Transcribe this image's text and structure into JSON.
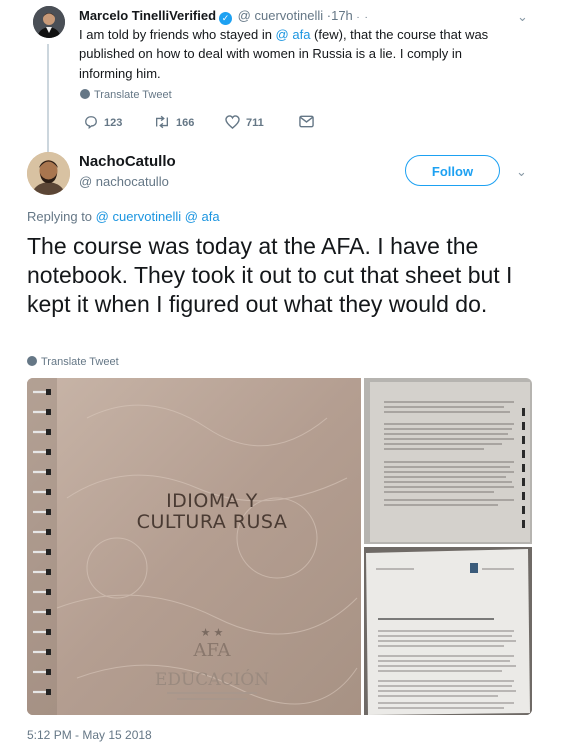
{
  "parent_tweet": {
    "name": "Marcelo Tinelli",
    "verified_label": "Verified",
    "handle": "@ cuervotinelli",
    "dot": "·",
    "time": "17h",
    "caret": "⌄",
    "text_1": "I am told by friends who stayed in ",
    "mention": "@ afa",
    "text_2": " (few), that the course that was published on how to deal with women in Russia is a lie. I comply in informing him.",
    "translate_label": "Translate Tweet",
    "actions": {
      "replies": "123",
      "retweets": "166",
      "likes": "711"
    }
  },
  "main_tweet": {
    "name": "NachoCatullo",
    "handle": "@ nachocatullo",
    "follow_label": "Follow",
    "caret": "⌄",
    "replying_prefix": "Replying to ",
    "replying_1": "@ cuervotinelli",
    "replying_2": "@ afa",
    "text": "The course was today at the AFA. I have the notebook. They took it out to cut that sheet but I kept it when I figured out what they would do.",
    "translate_label": "Translate Tweet",
    "media": {
      "notebook_title_line1": "IDIOMA Y",
      "notebook_title_line2": "CULTURA RUSA",
      "notebook_logo": "AFA",
      "notebook_stars": "★ ★",
      "notebook_footer": "EDUCACIÓN"
    },
    "timestamp": "5:12 PM - May 15 2018"
  },
  "colors": {
    "link": "#1b95e0",
    "muted": "#657786",
    "accent": "#1da1f2",
    "verified": "#1da1f2"
  }
}
